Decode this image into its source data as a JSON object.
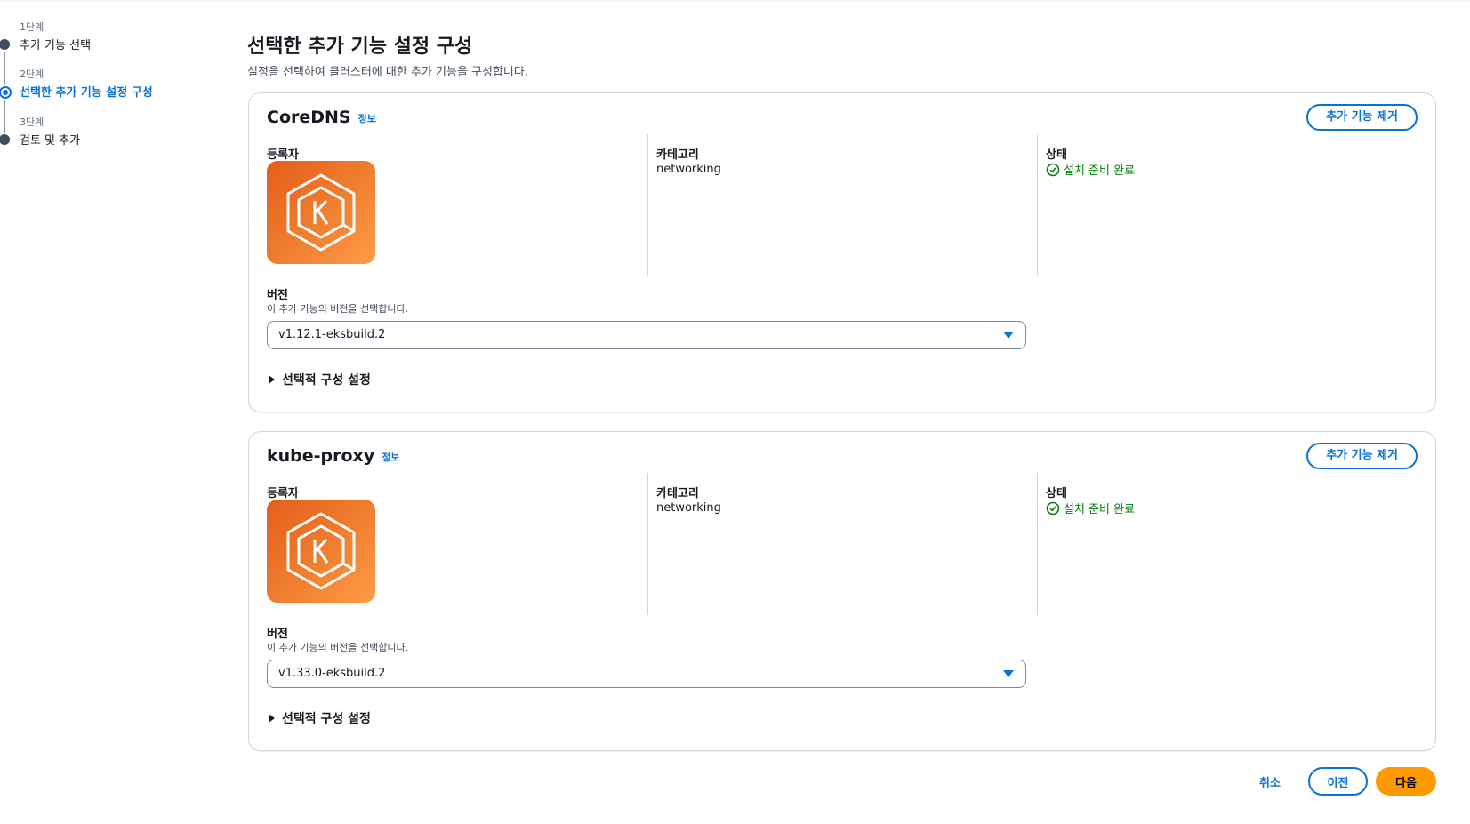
{
  "steps": [
    {
      "num": "1단계",
      "title": "추가 기능 선택",
      "state": "completed"
    },
    {
      "num": "2단계",
      "title": "선택한 추가 기능 설정 구성",
      "state": "active"
    },
    {
      "num": "3단계",
      "title": "검토 및 추가",
      "state": "upcoming"
    }
  ],
  "header": {
    "title": "선택한 추가 기능 설정 구성",
    "description": "설정을 선택하여 클러스터에 대한 추가 기능을 구성합니다."
  },
  "addons": [
    {
      "name": "CoreDNS",
      "info_label": "정보",
      "remove_label": "추가 기능 제거",
      "publisher_label": "등록자",
      "publisher_logo_icon": "kubernetes-k-hexagon-icon",
      "category_label": "카테고리",
      "category_value": "networking",
      "status_label": "상태",
      "status_value": "설치 준비 완료",
      "version_label": "버전",
      "version_description": "이 추가 기능의 버전을 선택합니다.",
      "version_value": "v1.12.1-eksbuild.2",
      "optional_settings_label": "선택적 구성 설정"
    },
    {
      "name": "kube-proxy",
      "info_label": "정보",
      "remove_label": "추가 기능 제거",
      "publisher_label": "등록자",
      "publisher_logo_icon": "kubernetes-k-hexagon-icon",
      "category_label": "카테고리",
      "category_value": "networking",
      "status_label": "상태",
      "status_value": "설치 준비 완료",
      "version_label": "버전",
      "version_description": "이 추가 기능의 버전을 선택합니다.",
      "version_value": "v1.33.0-eksbuild.2",
      "optional_settings_label": "선택적 구성 설정"
    }
  ],
  "footer": {
    "cancel_label": "취소",
    "previous_label": "이전",
    "next_label": "다음"
  },
  "colors": {
    "primary": "#0972d3",
    "success": "#037f0c",
    "next_button": "#ff9900",
    "logo_orange": "#f08030"
  }
}
